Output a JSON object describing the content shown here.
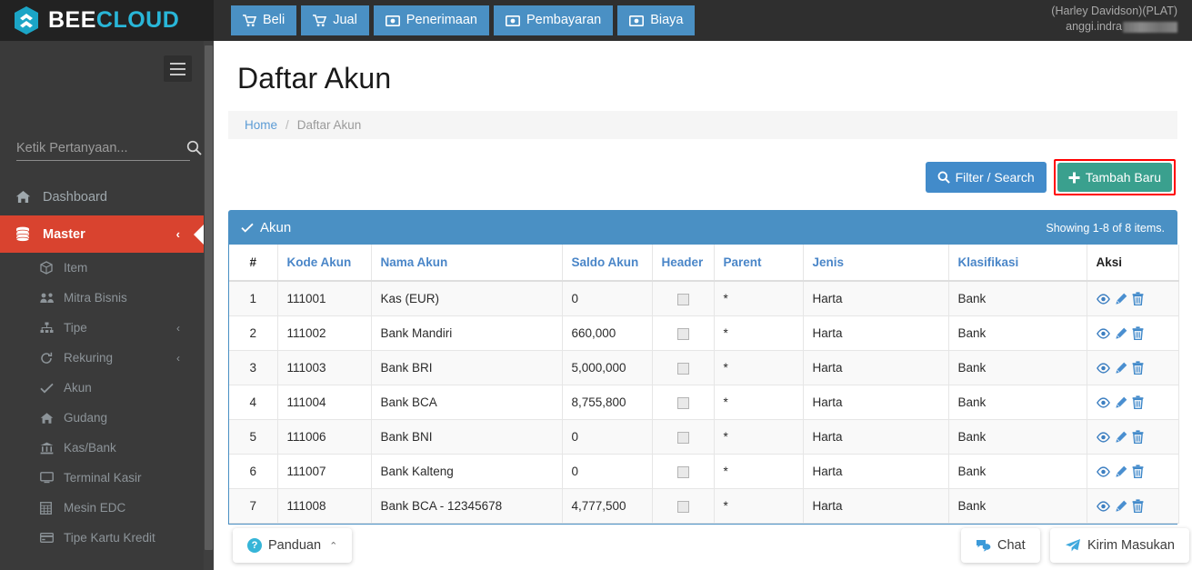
{
  "brand": {
    "part1": "BEE",
    "part2": "CLOUD",
    "logo_icon": "hexagon-bee-icon"
  },
  "topnav": {
    "items": [
      {
        "label": "Beli",
        "icon": "shopping-cart-icon"
      },
      {
        "label": "Jual",
        "icon": "shopping-cart-icon"
      },
      {
        "label": "Penerimaan",
        "icon": "money-bill-icon"
      },
      {
        "label": "Pembayaran",
        "icon": "money-bill-icon"
      },
      {
        "label": "Biaya",
        "icon": "money-bill-icon"
      }
    ]
  },
  "user": {
    "company": "(Harley Davidson)(PLAT)",
    "username": "anggi.indra"
  },
  "sidebar": {
    "search_placeholder": "Ketik Pertanyaan...",
    "search_value": "",
    "items": [
      {
        "label": "Dashboard",
        "icon": "home-icon",
        "active": false,
        "caret": ""
      },
      {
        "label": "Master",
        "icon": "database-icon",
        "active": true,
        "caret": "‹"
      }
    ],
    "submenu": [
      {
        "label": "Item",
        "icon": "cube-icon",
        "caret": ""
      },
      {
        "label": "Mitra Bisnis",
        "icon": "users-icon",
        "caret": ""
      },
      {
        "label": "Tipe",
        "icon": "sitemap-icon",
        "caret": "‹"
      },
      {
        "label": "Rekuring",
        "icon": "refresh-icon",
        "caret": "‹"
      },
      {
        "label": "Akun",
        "icon": "check-icon",
        "caret": ""
      },
      {
        "label": "Gudang",
        "icon": "home-icon",
        "caret": ""
      },
      {
        "label": "Kas/Bank",
        "icon": "bank-icon",
        "caret": ""
      },
      {
        "label": "Terminal Kasir",
        "icon": "desktop-icon",
        "caret": ""
      },
      {
        "label": "Mesin EDC",
        "icon": "calculator-icon",
        "caret": ""
      },
      {
        "label": "Tipe Kartu Kredit",
        "icon": "credit-card-icon",
        "caret": ""
      }
    ]
  },
  "main": {
    "title": "Daftar Akun",
    "breadcrumb": {
      "home": "Home",
      "separator": "/",
      "current": "Daftar Akun"
    },
    "filter_button": "Filter / Search",
    "add_button": "Tambah Baru",
    "add_button_highlight_color": "#ff0000",
    "panel": {
      "title": "Akun",
      "title_icon": "check-icon",
      "showing": "Showing 1-8 of 8 items."
    },
    "table": {
      "columns": [
        {
          "label": "#",
          "sortable": false
        },
        {
          "label": "Kode Akun",
          "sortable": true
        },
        {
          "label": "Nama Akun",
          "sortable": true
        },
        {
          "label": "Saldo Akun",
          "sortable": true
        },
        {
          "label": "Header",
          "sortable": true
        },
        {
          "label": "Parent",
          "sortable": true
        },
        {
          "label": "Jenis",
          "sortable": true
        },
        {
          "label": "Klasifikasi",
          "sortable": true
        },
        {
          "label": "Aksi",
          "sortable": false
        }
      ],
      "rows": [
        {
          "no": "1",
          "kode": "111001",
          "nama": "Kas (EUR)",
          "saldo": "0",
          "header": false,
          "parent": "*",
          "jenis": "Harta",
          "klasifikasi": "Bank"
        },
        {
          "no": "2",
          "kode": "111002",
          "nama": "Bank Mandiri",
          "saldo": "660,000",
          "header": false,
          "parent": "*",
          "jenis": "Harta",
          "klasifikasi": "Bank"
        },
        {
          "no": "3",
          "kode": "111003",
          "nama": "Bank BRI",
          "saldo": "5,000,000",
          "header": false,
          "parent": "*",
          "jenis": "Harta",
          "klasifikasi": "Bank"
        },
        {
          "no": "4",
          "kode": "111004",
          "nama": "Bank BCA",
          "saldo": "8,755,800",
          "header": false,
          "parent": "*",
          "jenis": "Harta",
          "klasifikasi": "Bank"
        },
        {
          "no": "5",
          "kode": "111006",
          "nama": "Bank BNI",
          "saldo": "0",
          "header": false,
          "parent": "*",
          "jenis": "Harta",
          "klasifikasi": "Bank"
        },
        {
          "no": "6",
          "kode": "111007",
          "nama": "Bank Kalteng",
          "saldo": "0",
          "header": false,
          "parent": "*",
          "jenis": "Harta",
          "klasifikasi": "Bank"
        },
        {
          "no": "7",
          "kode": "111008",
          "nama": "Bank BCA - 12345678",
          "saldo": "4,777,500",
          "header": false,
          "parent": "*",
          "jenis": "Harta",
          "klasifikasi": "Bank"
        }
      ],
      "action_icons": [
        "eye-icon",
        "pencil-icon",
        "trash-icon"
      ]
    }
  },
  "footer_widgets": {
    "panduan": {
      "label": "Panduan",
      "icon": "question-circle-icon",
      "caret": "⌃"
    },
    "chat": {
      "label": "Chat",
      "icon": "comments-icon"
    },
    "masukan": {
      "label": "Kirim Masukan",
      "icon": "paper-plane-icon"
    }
  },
  "colors": {
    "brand_cyan": "#29b6d8",
    "nav_blue": "#4a90c4",
    "active_red": "#d9432f",
    "teal": "#3aa08e",
    "link_blue": "#5b9bd5"
  }
}
